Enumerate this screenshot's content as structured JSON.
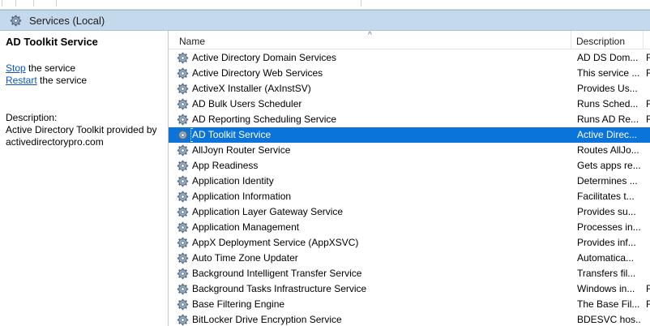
{
  "window": {
    "title": "Services (Local)"
  },
  "details": {
    "service_name": "AD Toolkit Service",
    "stop_link": "Stop",
    "stop_suffix": " the service",
    "restart_link": "Restart",
    "restart_suffix": " the service",
    "description_label": "Description:",
    "description_text": "Active Directory Toolkit provided by activedirectorypro.com"
  },
  "columns": {
    "name": "Name",
    "description": "Description"
  },
  "icons": {
    "service": "gear-icon",
    "sort": "sort-up-icon"
  },
  "colors": {
    "selection": "#0a74da",
    "header_bar": "#c5d9ec",
    "link": "#0b56c4"
  },
  "services": [
    {
      "name": "Active Directory Domain Services",
      "description": "AD DS Dom...",
      "status": "R"
    },
    {
      "name": "Active Directory Web Services",
      "description": "This service ...",
      "status": "R"
    },
    {
      "name": "ActiveX Installer (AxInstSV)",
      "description": "Provides Us...",
      "status": ""
    },
    {
      "name": "AD Bulk Users Scheduler",
      "description": "Runs Sched...",
      "status": "R"
    },
    {
      "name": "AD Reporting Scheduling Service",
      "description": "Runs AD Re...",
      "status": "R"
    },
    {
      "name": "AD Toolkit Service",
      "description": "Active Direc...",
      "status": "",
      "selected": true
    },
    {
      "name": "AllJoyn Router Service",
      "description": "Routes AllJo...",
      "status": ""
    },
    {
      "name": "App Readiness",
      "description": "Gets apps re...",
      "status": ""
    },
    {
      "name": "Application Identity",
      "description": "Determines ...",
      "status": ""
    },
    {
      "name": "Application Information",
      "description": "Facilitates t...",
      "status": ""
    },
    {
      "name": "Application Layer Gateway Service",
      "description": "Provides su...",
      "status": ""
    },
    {
      "name": "Application Management",
      "description": "Processes in...",
      "status": ""
    },
    {
      "name": "AppX Deployment Service (AppXSVC)",
      "description": "Provides inf...",
      "status": ""
    },
    {
      "name": "Auto Time Zone Updater",
      "description": "Automatica...",
      "status": ""
    },
    {
      "name": "Background Intelligent Transfer Service",
      "description": "Transfers fil...",
      "status": ""
    },
    {
      "name": "Background Tasks Infrastructure Service",
      "description": "Windows in...",
      "status": "R"
    },
    {
      "name": "Base Filtering Engine",
      "description": "The Base Fil...",
      "status": "R"
    },
    {
      "name": "BitLocker Drive Encryption Service",
      "description": "BDESVC hos...",
      "status": ""
    }
  ]
}
